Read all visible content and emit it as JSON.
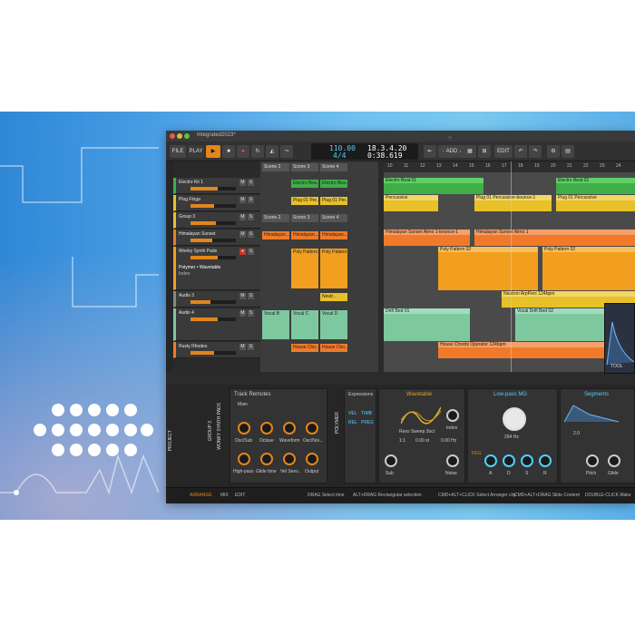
{
  "window": {
    "project_name": "Integrated2023*"
  },
  "toolbar": {
    "file_label": "FILE",
    "play_label": "PLAY",
    "tempo": "110.00",
    "time_signature": "4/4",
    "position_bars": "18.3.4.20",
    "position_time": "0:38.619",
    "add_label": "ADD",
    "edit_label": "EDIT"
  },
  "tracks": [
    {
      "name": "Electro Kit 1",
      "color": "#3fae49"
    },
    {
      "name": "Plug Finga",
      "color": "#e8c12a"
    },
    {
      "name": "Group 3",
      "color": "#e8c12a"
    },
    {
      "name": "Himalayan Sunset",
      "color": "#f07a2a"
    },
    {
      "name": "Wonky Synth Pads",
      "color": "#f29e1e"
    },
    {
      "name": "Polymer • Wavetable",
      "color": "#f29e1e"
    },
    {
      "name": "Index",
      "color": "#f29e1e"
    },
    {
      "name": "Audio 3",
      "color": "#888888"
    },
    {
      "name": "Audio 4",
      "color": "#7ec8a0"
    },
    {
      "name": "Rusty Rhodes",
      "color": "#f07a2a"
    }
  ],
  "launcher": {
    "scenes": [
      "Scene 2",
      "Scene 3",
      "Scene 4"
    ],
    "clips": {
      "row1": [
        "Electro Bea...",
        "Electro Bea..."
      ],
      "row2": [
        "Plug 01 Per...",
        "Plug 01 Per..."
      ],
      "row3": [
        "Scene 2",
        "Scene 3",
        "Scene 4"
      ],
      "row4": [
        "Himalayan...",
        "Himalayan...",
        "Himalayan..."
      ],
      "row5": [
        "Poly Pattern...",
        "Poly Pattern..."
      ],
      "row6": [
        "Neutr..."
      ],
      "row7": [
        "Vocal B",
        "Vocal C",
        "Vocal D"
      ],
      "row8": [
        "House Cho...",
        "House Cho..."
      ]
    }
  },
  "arranger": {
    "ruler": [
      "10",
      "11",
      "12",
      "13",
      "14",
      "15",
      "16",
      "17",
      "18",
      "19",
      "20",
      "21",
      "22",
      "23",
      "24"
    ],
    "clips": {
      "electro_1": "Electro Beat 01",
      "electro_2": "Electro Beat 02",
      "plug_1": "Percussive",
      "plug_2": "Plug 01 Percussive-bounce-1",
      "plug_3": "Plug 01 Percussive",
      "sunset_1": "Himalayan Sunset Atmo 1-bounce-1",
      "sunset_2": "Himalayan Sunset Atmo 1",
      "poly_1": "Poly Pattern 02",
      "poly_2": "Poly Pattern 02",
      "neutron": "Neutron ArpPerc 124bpm",
      "vocal_1": "Drift Bed 01",
      "vocal_2": "Vocal Drift Bed 02",
      "house": "House Chords Operator 124bpm"
    }
  },
  "devices": {
    "side_tabs": [
      "PROJECT",
      "GROUP 3",
      "WONKY SYNTH PADS",
      "POLYMER"
    ],
    "remotes_title": "Track Remotes",
    "remotes_page": "Main",
    "remotes_knobs": [
      "Osc/Sub",
      "Octave",
      "Waveform",
      "Osc/Noi...",
      "High-pass",
      "Glide time",
      "Vel Sens.",
      "Output"
    ],
    "expressions_title": "Expressions",
    "expr_labels": [
      "VEL",
      "TIMB",
      "REL",
      "PRES"
    ],
    "osc_title": "Wavetable",
    "wavetable_name": "Reso Sweep 3oct",
    "index_label": "Index",
    "pitch_values": [
      "1:1",
      "0.00 st",
      "0.00 Hz"
    ],
    "osc_bottom": [
      "Sub",
      "Noise"
    ],
    "filter_title": "Low-pass MG",
    "filter_freq": "294 Hz",
    "filter_bottom": [
      "A",
      "D",
      "S",
      "R"
    ],
    "segments_title": "Segments",
    "segments_value": "2.0",
    "seg_bottom": [
      "Pitch",
      "Glide"
    ]
  },
  "popup": {
    "tool_label": "TOOL"
  },
  "statusbar": {
    "tabs": [
      "ARRANGE",
      "MIX",
      "EDIT"
    ],
    "hints": [
      "DRAG  Select time",
      "ALT+DRAG  Rectangular selection",
      "CMD+ALT+CLICK  Select Arranger clip",
      "CMD+ALT+DRAG  Slide Content",
      "DOUBLE-CLICK  Make"
    ]
  }
}
